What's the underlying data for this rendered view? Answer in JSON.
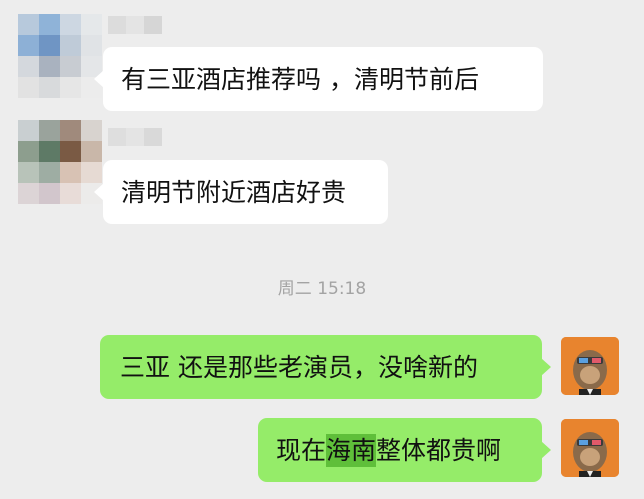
{
  "chat": {
    "timestamp": "周二 15:18",
    "messages": [
      {
        "sender": "other",
        "text": "有三亚酒店推荐吗 ，清明节前后"
      },
      {
        "sender": "other",
        "text": "清明节附近酒店好贵"
      },
      {
        "sender": "self",
        "text": "三亚 还是那些老演员，没啥新的"
      },
      {
        "sender": "self",
        "text_before": "现在",
        "highlight": "海南",
        "text_after": "整体都贵啊"
      }
    ]
  },
  "colors": {
    "background": "#ededed",
    "incoming_bubble": "#ffffff",
    "outgoing_bubble": "#95ec69",
    "timestamp_text": "#a3a3a3"
  }
}
